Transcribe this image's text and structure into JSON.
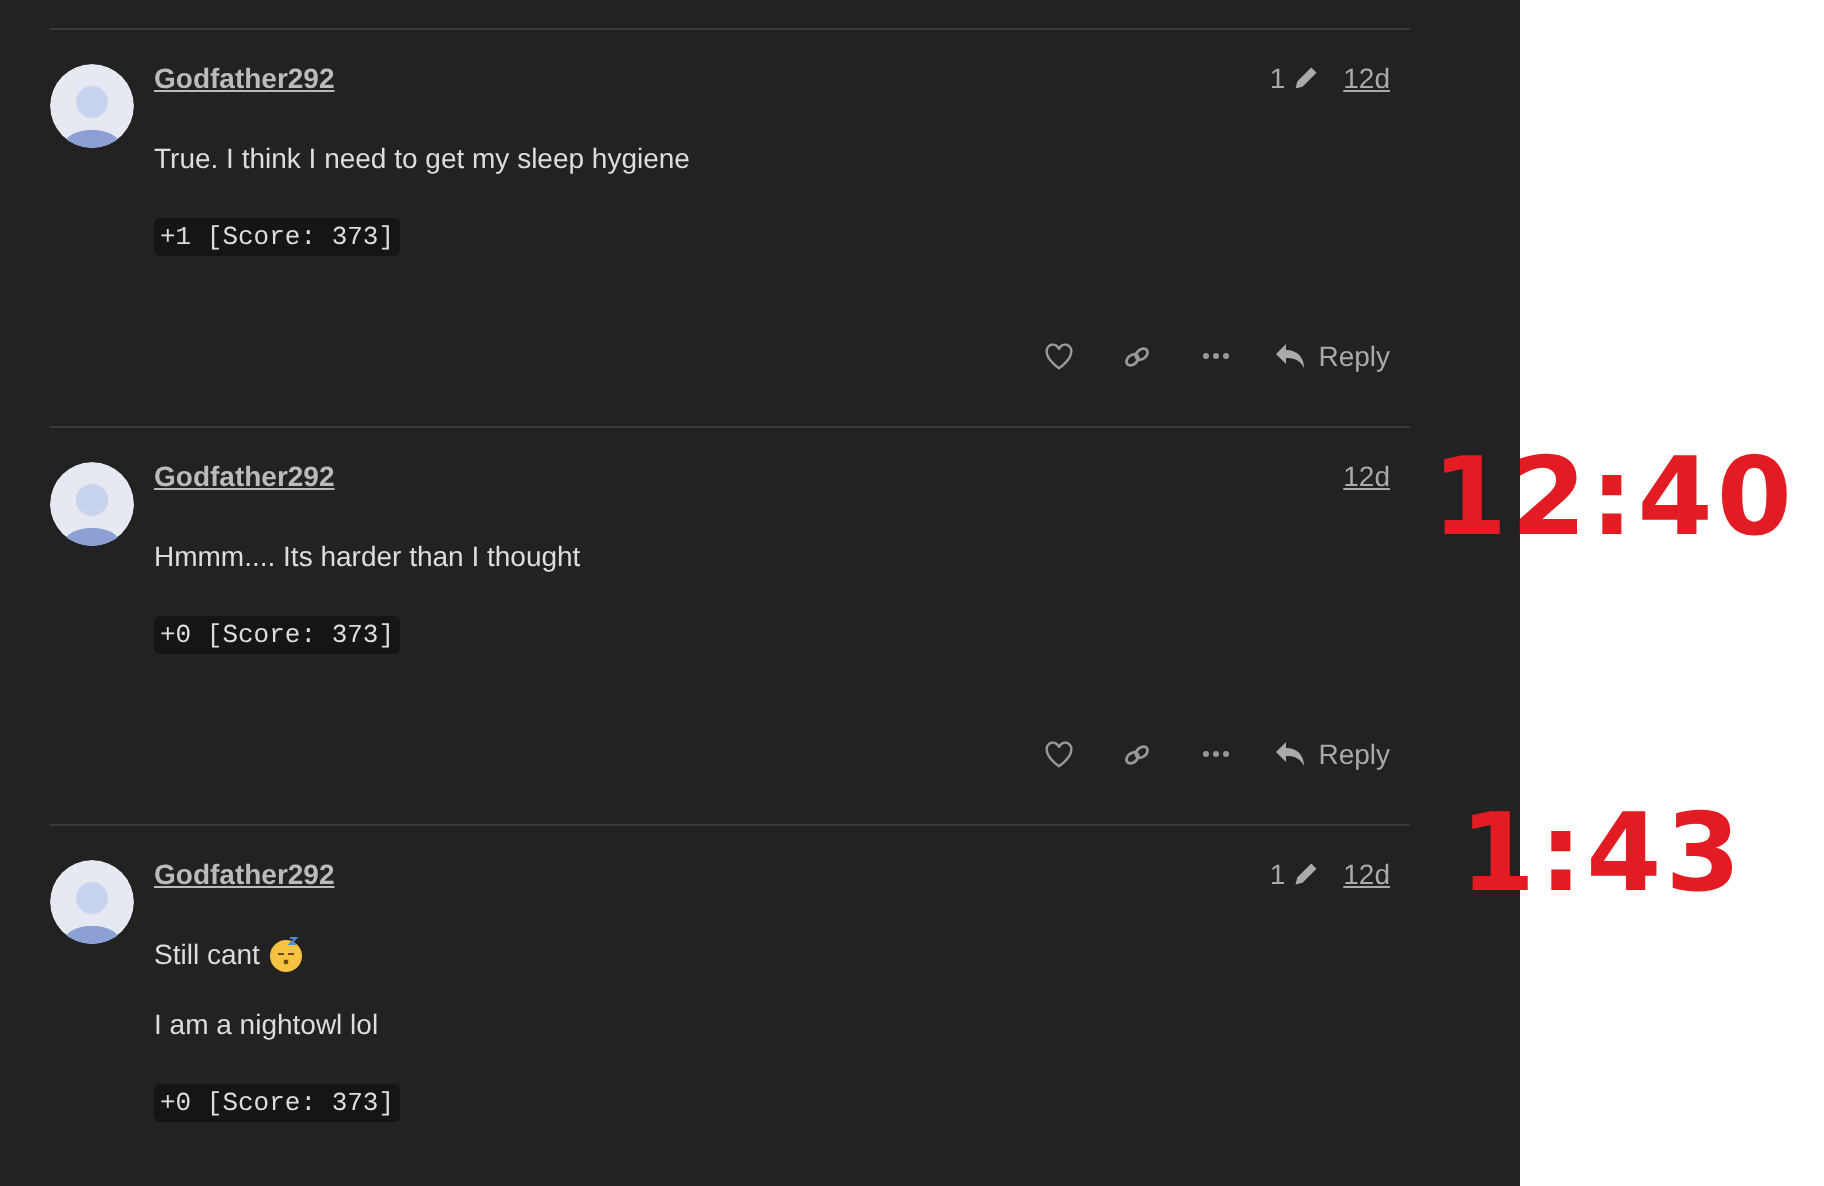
{
  "posts": [
    {
      "username": "Godfather292",
      "edits": "1",
      "time": "12d",
      "paragraphs": [
        {
          "text": "True. I think I need to get my sleep hygiene",
          "emoji": false
        }
      ],
      "score": "+1 [Score: 373]",
      "actions": {
        "reply": "Reply"
      }
    },
    {
      "username": "Godfather292",
      "time": "12d",
      "paragraphs": [
        {
          "text": "Hmmm.... Its harder than I thought",
          "emoji": false
        }
      ],
      "score": "+0 [Score: 373]",
      "actions": {
        "reply": "Reply"
      }
    },
    {
      "username": "Godfather292",
      "edits": "1",
      "time": "12d",
      "paragraphs": [
        {
          "text": "Still cant",
          "emoji": true
        },
        {
          "text": "I am a nightowl lol",
          "emoji": false
        }
      ],
      "score": "+0 [Score: 373]"
    }
  ],
  "annotations": [
    "12:40",
    "1:43"
  ]
}
